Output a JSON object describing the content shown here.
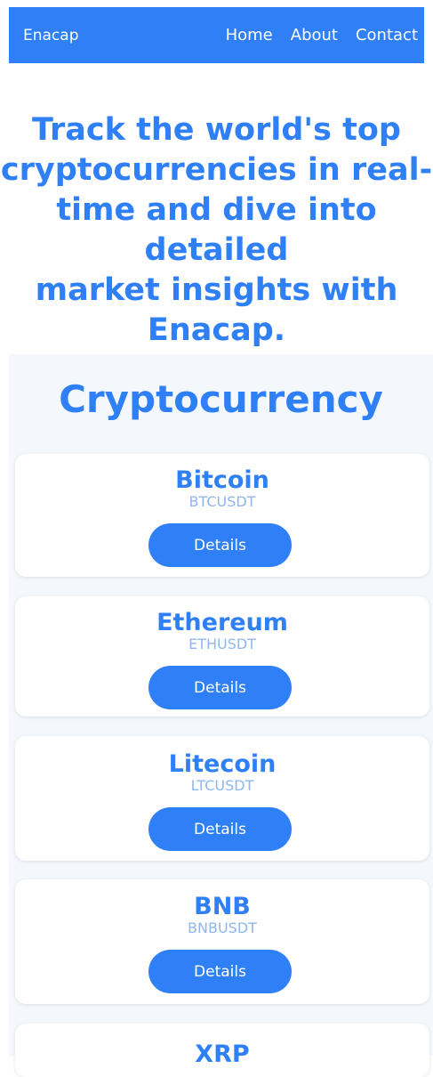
{
  "navbar": {
    "brand": "Enacap",
    "links": [
      "Home",
      "About",
      "Contact"
    ]
  },
  "hero": {
    "lines": [
      "Track the world's top",
      "cryptocurrencies in real-",
      "time and dive into detailed",
      "market insights with",
      "Enacap."
    ]
  },
  "section": {
    "title": "Cryptocurrency"
  },
  "cards": [
    {
      "name": "Bitcoin",
      "symbol": "BTCUSDT",
      "button": "Details"
    },
    {
      "name": "Ethereum",
      "symbol": "ETHUSDT",
      "button": "Details"
    },
    {
      "name": "Litecoin",
      "symbol": "LTCUSDT",
      "button": "Details"
    },
    {
      "name": "BNB",
      "symbol": "BNBUSDT",
      "button": "Details"
    },
    {
      "name": "XRP"
    }
  ],
  "colors": {
    "primary": "#2f80f7",
    "symbol": "#8fb6f0",
    "section_bg": "#f4f8fc"
  }
}
